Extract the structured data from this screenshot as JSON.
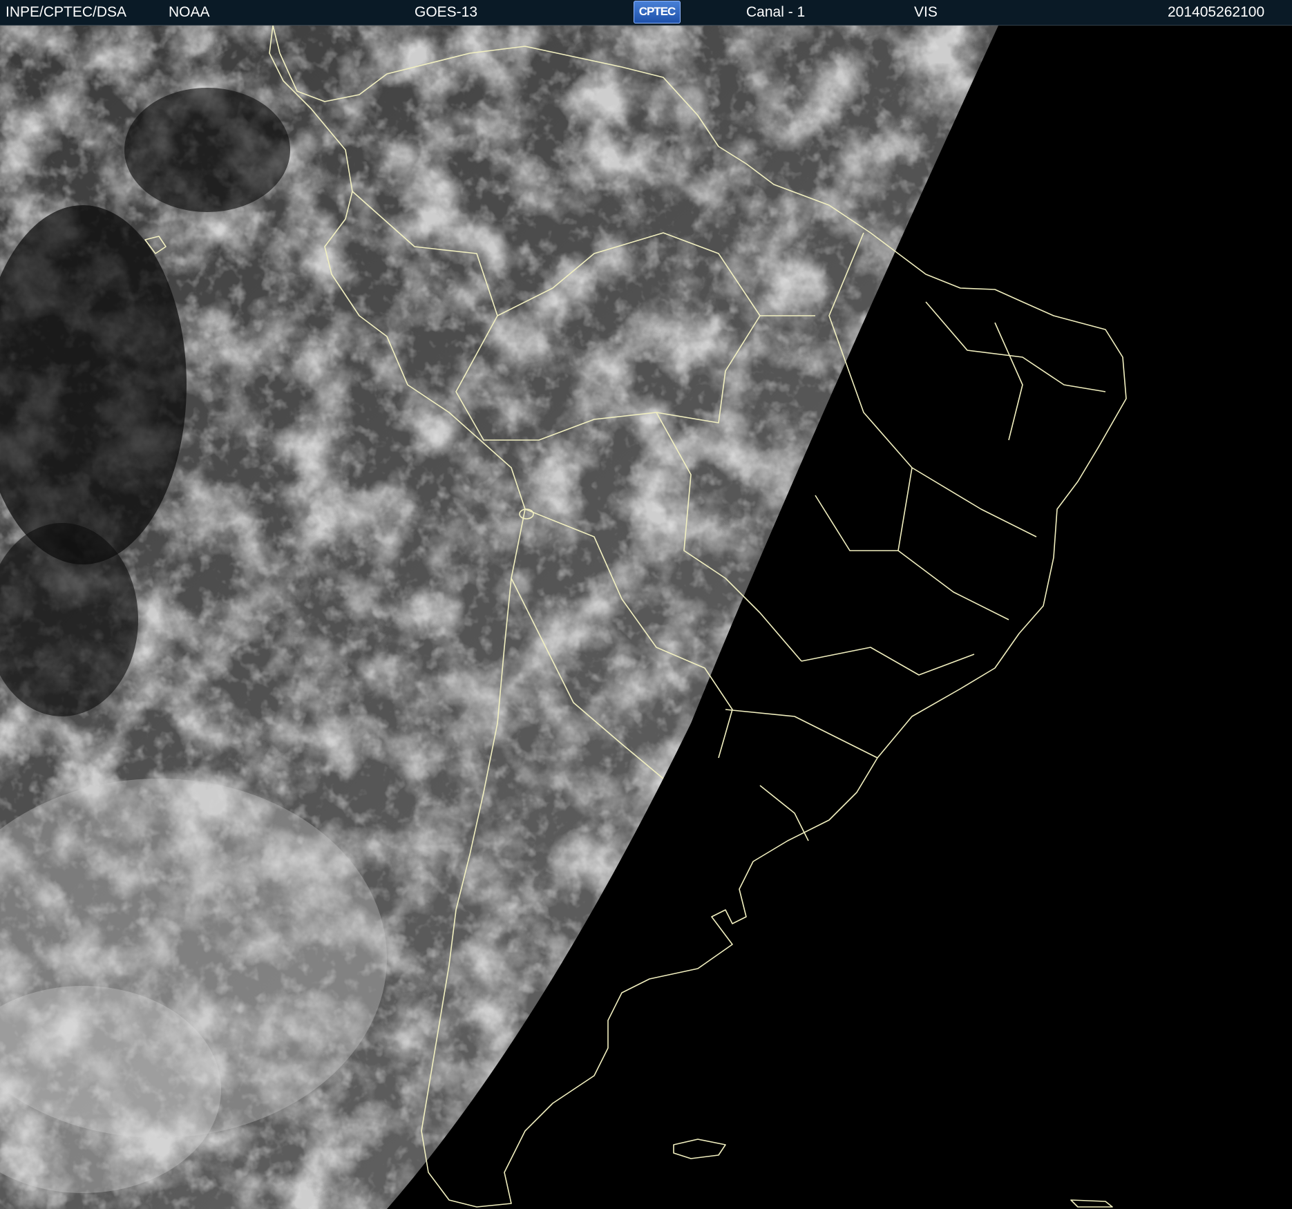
{
  "header": {
    "agency": "INPE/CPTEC/DSA",
    "source": "NOAA",
    "satellite": "GOES-13",
    "logo_text": "CPTEC",
    "channel": "Canal - 1",
    "band": "VIS",
    "timestamp": "201405262100"
  },
  "colors": {
    "header_bg": "#0a1a26",
    "header_text": "#ffffff",
    "coastline": "#f2f0c0",
    "night_side": "#000000",
    "day_side": "#5a5a5a",
    "cloud": "#d8d8d8"
  },
  "image": {
    "type": "satellite-visible-channel",
    "region": "South America",
    "terminator": "day/night boundary curving from top-center to bottom-left"
  }
}
